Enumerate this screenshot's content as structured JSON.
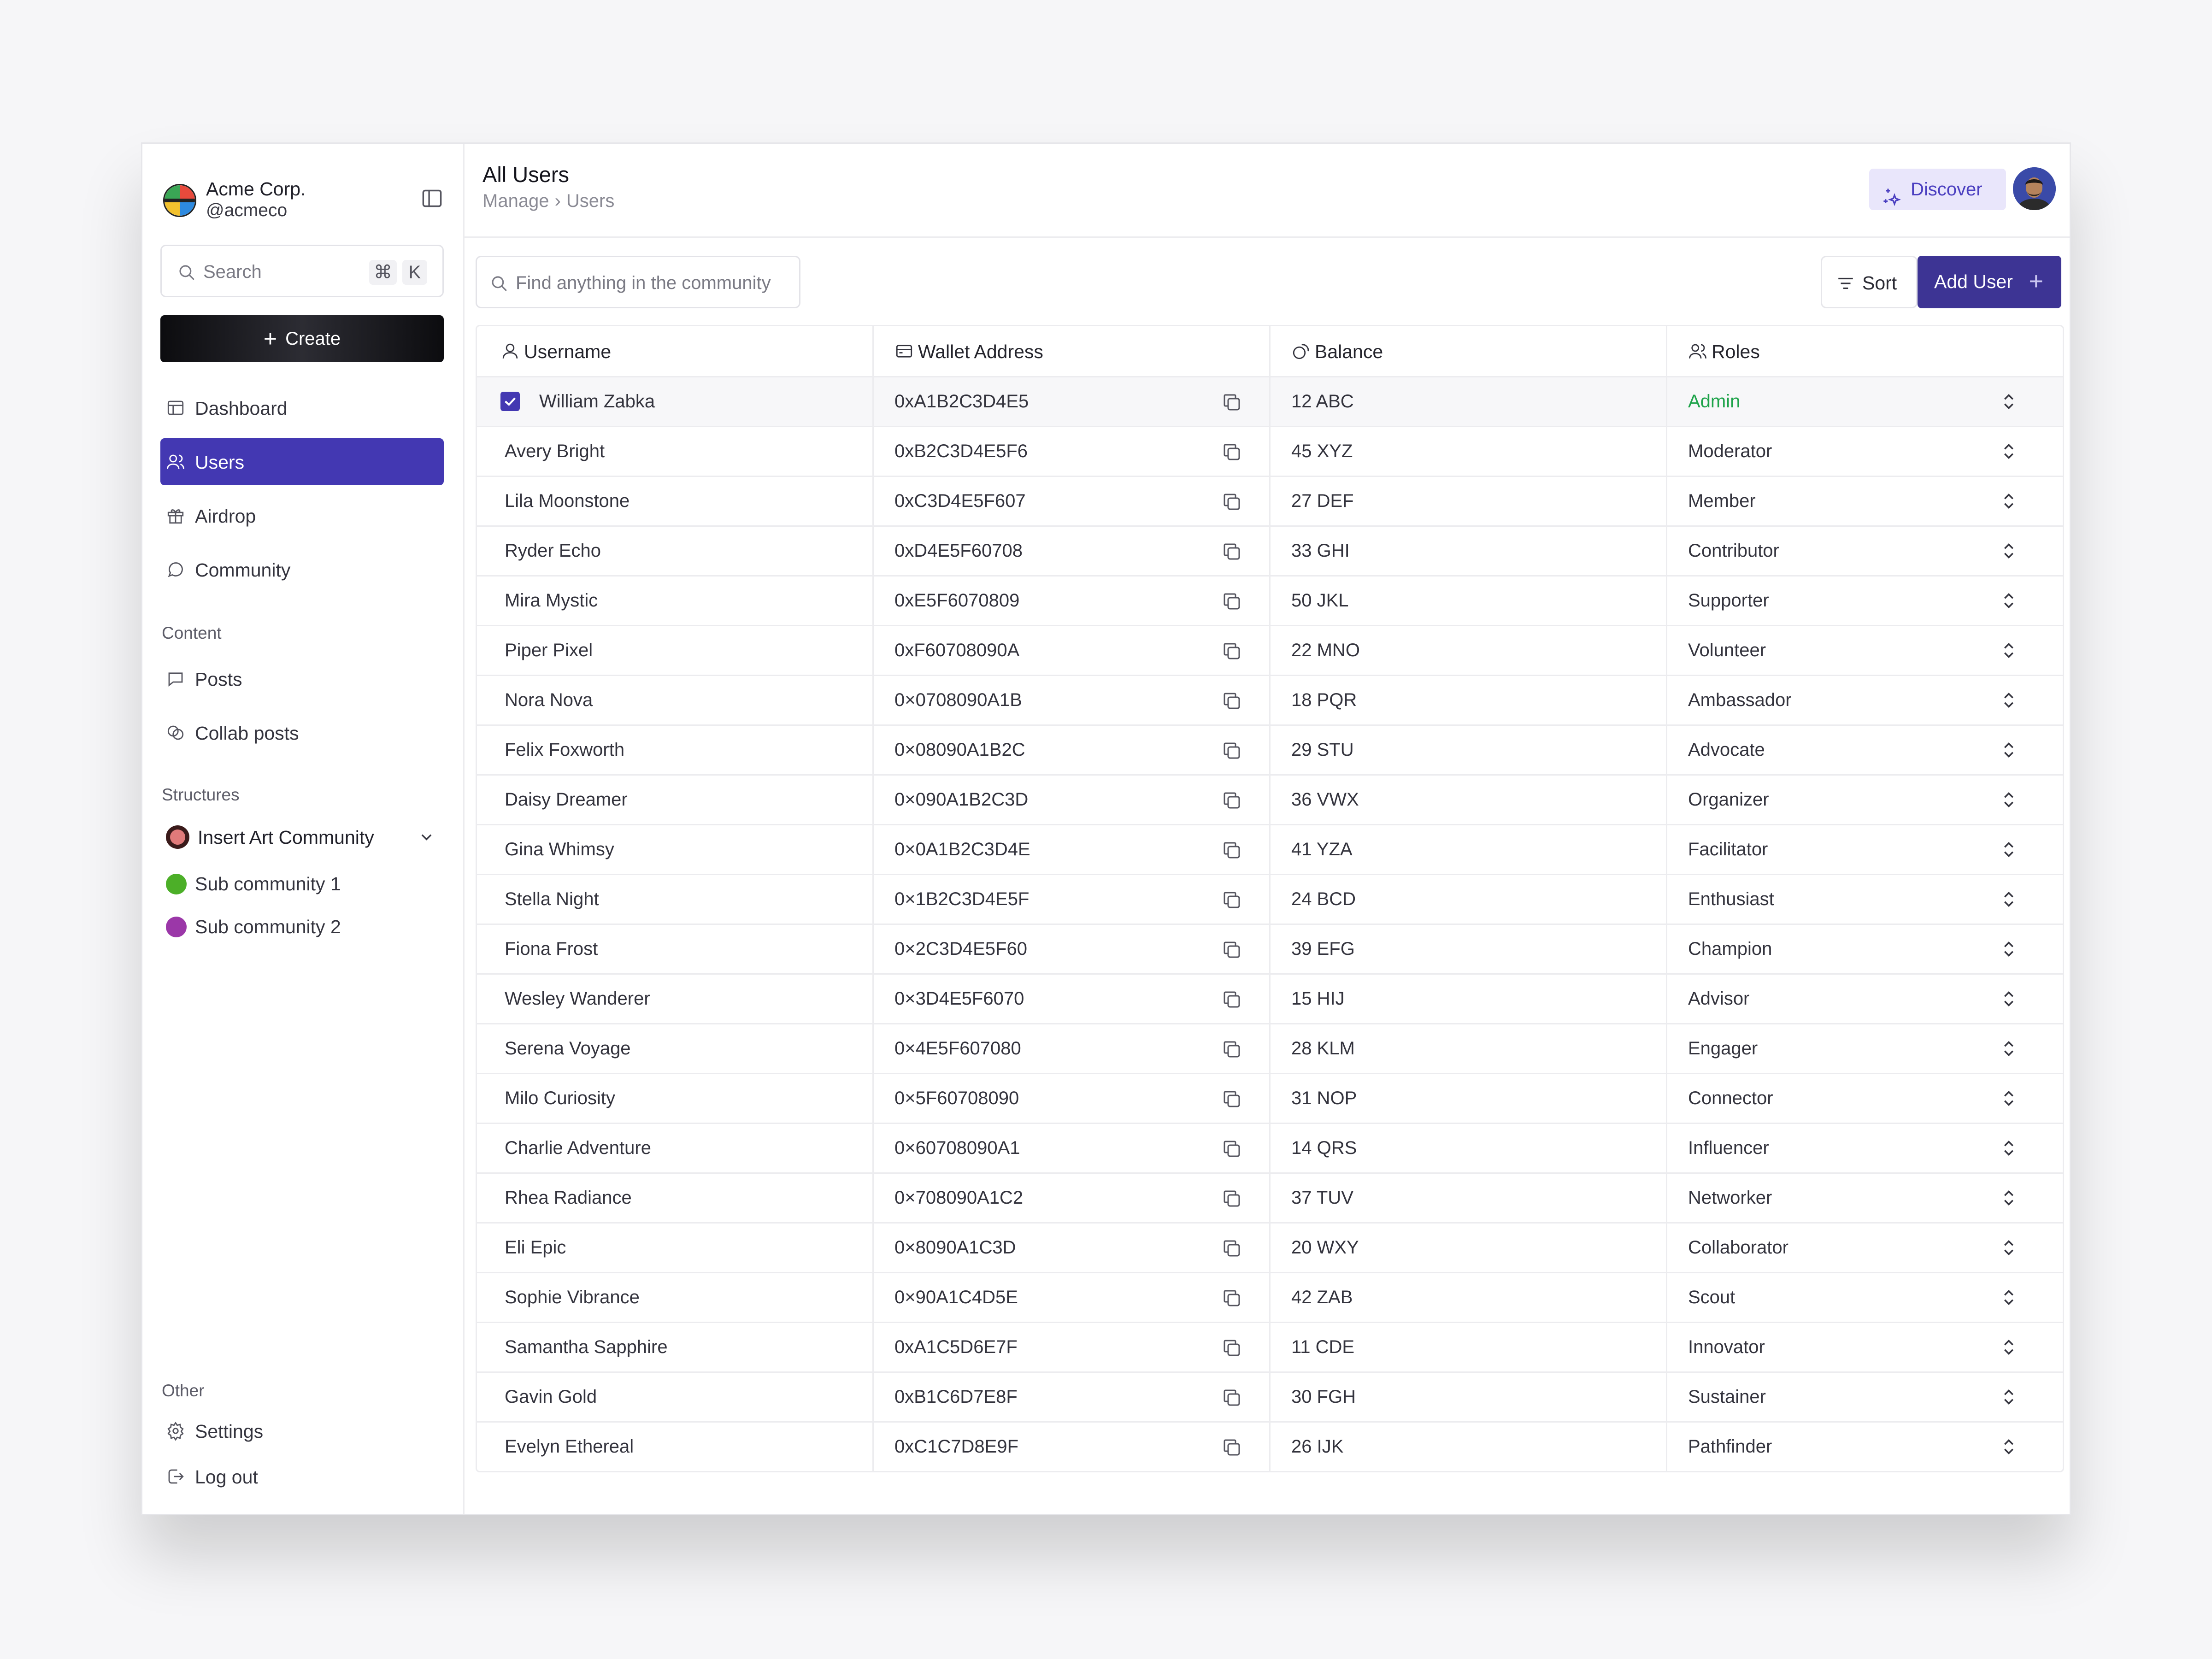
{
  "org": {
    "name": "Acme Corp.",
    "handle": "@acmeco"
  },
  "search": {
    "label": "Search",
    "shortcut_cmd": "⌘",
    "shortcut_key": "K"
  },
  "create": {
    "label": "Create"
  },
  "nav": [
    {
      "label": "Dashboard",
      "icon": "dashboard-icon"
    },
    {
      "label": "Users",
      "icon": "users-icon",
      "active": true
    },
    {
      "label": "Airdrop",
      "icon": "gift-icon"
    },
    {
      "label": "Community",
      "icon": "chat-icon"
    }
  ],
  "content_section": {
    "title": "Content",
    "items": [
      {
        "label": "Posts"
      },
      {
        "label": "Collab posts"
      }
    ]
  },
  "structures": {
    "title": "Structures",
    "main": "Insert Art Community",
    "subs": [
      {
        "label": "Sub community 1",
        "color": "#4caf28"
      },
      {
        "label": "Sub community 2",
        "color": "#9b37a8"
      }
    ]
  },
  "other": {
    "title": "Other",
    "settings": "Settings",
    "logout": "Log out"
  },
  "header": {
    "title": "All Users",
    "crumb_parent": "Manage",
    "crumb_sep": "›",
    "crumb_current": "Users",
    "discover": "Discover"
  },
  "toolbar": {
    "find_placeholder": "Find anything in the community",
    "sort": "Sort",
    "add_user": "Add User"
  },
  "table": {
    "columns": [
      "Username",
      "Wallet Address",
      "Balance",
      "Roles"
    ],
    "rows": [
      {
        "username": "William Zabka",
        "wallet": "0xA1B2C3D4E5",
        "balance": "12 ABC",
        "role": "Admin",
        "selected": true
      },
      {
        "username": "Avery Bright",
        "wallet": "0xB2C3D4E5F6",
        "balance": "45 XYZ",
        "role": "Moderator"
      },
      {
        "username": "Lila Moonstone",
        "wallet": "0xC3D4E5F607",
        "balance": "27 DEF",
        "role": "Member"
      },
      {
        "username": "Ryder Echo",
        "wallet": "0xD4E5F60708",
        "balance": "33 GHI",
        "role": "Contributor"
      },
      {
        "username": "Mira Mystic",
        "wallet": "0xE5F6070809",
        "balance": "50 JKL",
        "role": "Supporter"
      },
      {
        "username": "Piper Pixel",
        "wallet": "0xF60708090A",
        "balance": "22 MNO",
        "role": "Volunteer"
      },
      {
        "username": "Nora Nova",
        "wallet": "0×0708090A1B",
        "balance": "18 PQR",
        "role": "Ambassador"
      },
      {
        "username": "Felix Foxworth",
        "wallet": "0×08090A1B2C",
        "balance": "29 STU",
        "role": "Advocate"
      },
      {
        "username": "Daisy Dreamer",
        "wallet": "0×090A1B2C3D",
        "balance": "36 VWX",
        "role": "Organizer"
      },
      {
        "username": "Gina Whimsy",
        "wallet": "0×0A1B2C3D4E",
        "balance": "41 YZA",
        "role": "Facilitator"
      },
      {
        "username": "Stella Night",
        "wallet": "0×1B2C3D4E5F",
        "balance": "24 BCD",
        "role": "Enthusiast"
      },
      {
        "username": "Fiona Frost",
        "wallet": "0×2C3D4E5F60",
        "balance": "39 EFG",
        "role": "Champion"
      },
      {
        "username": "Wesley Wanderer",
        "wallet": "0×3D4E5F6070",
        "balance": "15 HIJ",
        "role": "Advisor"
      },
      {
        "username": "Serena Voyage",
        "wallet": "0×4E5F607080",
        "balance": "28 KLM",
        "role": "Engager"
      },
      {
        "username": "Milo Curiosity",
        "wallet": "0×5F60708090",
        "balance": "31 NOP",
        "role": "Connector"
      },
      {
        "username": "Charlie Adventure",
        "wallet": "0×60708090A1",
        "balance": "14 QRS",
        "role": "Influencer"
      },
      {
        "username": "Rhea Radiance",
        "wallet": "0×708090A1C2",
        "balance": "37 TUV",
        "role": "Networker"
      },
      {
        "username": "Eli Epic",
        "wallet": "0×8090A1C3D",
        "balance": "20 WXY",
        "role": "Collaborator"
      },
      {
        "username": "Sophie Vibrance",
        "wallet": "0×90A1C4D5E",
        "balance": "42 ZAB",
        "role": "Scout"
      },
      {
        "username": "Samantha Sapphire",
        "wallet": "0xA1C5D6E7F",
        "balance": "11 CDE",
        "role": "Innovator"
      },
      {
        "username": "Gavin Gold",
        "wallet": "0xB1C6D7E8F",
        "balance": "30 FGH",
        "role": "Sustainer"
      },
      {
        "username": "Evelyn Ethereal",
        "wallet": "0xC1C7D8E9F",
        "balance": "26 IJK",
        "role": "Pathfinder"
      }
    ]
  },
  "colors": {
    "accent": "#4338b2",
    "admin_role": "#1ea34a",
    "add_button": "#3d3494",
    "discover_bg": "#e9e6fb"
  }
}
